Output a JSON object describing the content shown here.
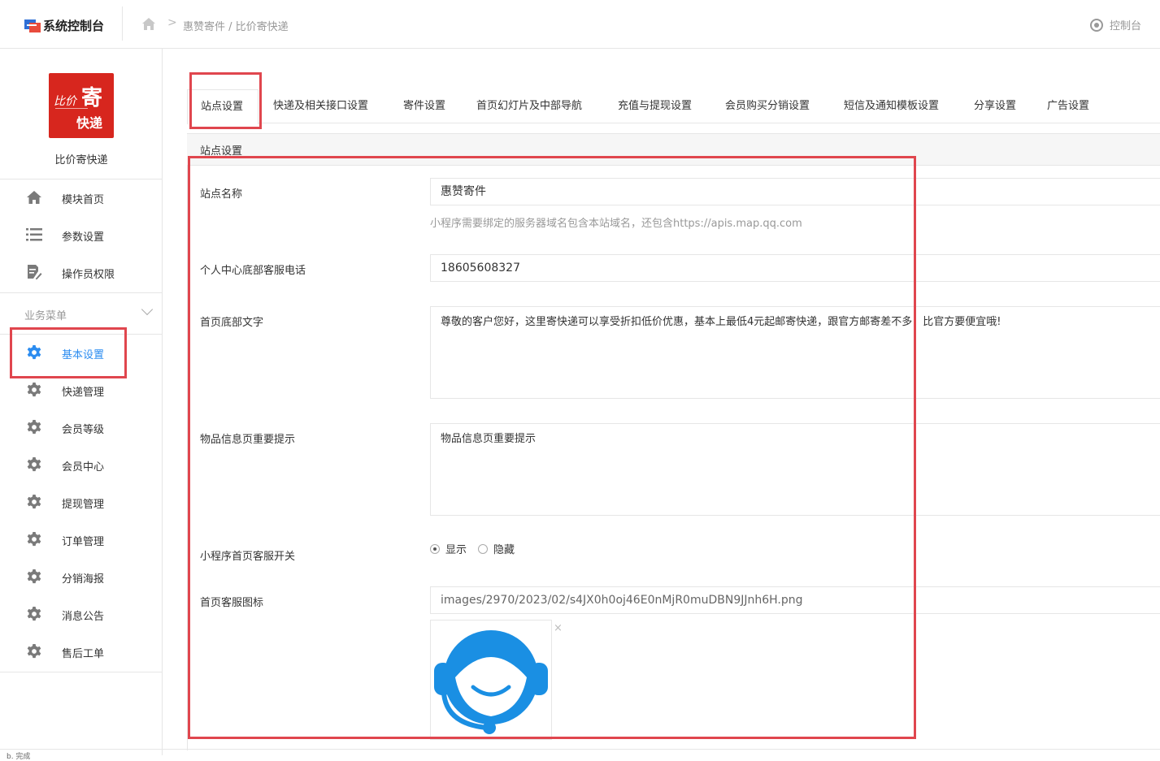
{
  "header": {
    "brand": "系统控制台",
    "breadcrumb": "惠赞寄件 / 比价寄快递",
    "breadcrumb_sep": ">",
    "console": "控制台"
  },
  "sidebar": {
    "logo": {
      "text_left": "比价",
      "text_top": "寄",
      "text_bottom": "快递"
    },
    "site_name": "比价寄快递",
    "top_items": [
      {
        "label": "模块首页",
        "icon": "home-icon"
      },
      {
        "label": "参数设置",
        "icon": "list-icon"
      },
      {
        "label": "操作员权限",
        "icon": "document-edit-icon"
      }
    ],
    "group_title": "业务菜单",
    "group_items": [
      {
        "label": "基本设置",
        "icon": "gear-icon",
        "active": true
      },
      {
        "label": "快递管理",
        "icon": "gear-icon"
      },
      {
        "label": "会员等级",
        "icon": "gear-icon"
      },
      {
        "label": "会员中心",
        "icon": "gear-icon"
      },
      {
        "label": "提现管理",
        "icon": "gear-icon"
      },
      {
        "label": "订单管理",
        "icon": "gear-icon"
      },
      {
        "label": "分销海报",
        "icon": "gear-icon"
      },
      {
        "label": "消息公告",
        "icon": "gear-icon"
      },
      {
        "label": "售后工单",
        "icon": "gear-icon"
      }
    ]
  },
  "tabs": [
    {
      "label": "站点设置",
      "active": true
    },
    {
      "label": "快递及相关接口设置"
    },
    {
      "label": "寄件设置"
    },
    {
      "label": "首页幻灯片及中部导航"
    },
    {
      "label": "充值与提现设置"
    },
    {
      "label": "会员购买分销设置"
    },
    {
      "label": "短信及通知模板设置"
    },
    {
      "label": "分享设置"
    },
    {
      "label": "广告设置"
    }
  ],
  "form": {
    "section_title": "站点设置",
    "site_name_label": "站点名称",
    "site_name_value": "惠赞寄件",
    "site_name_help": "小程序需要绑定的服务器域名包含本站域名，还包含https://apis.map.qq.com",
    "phone_label": "个人中心底部客服电话",
    "phone_value": "18605608327",
    "footer_label": "首页底部文字",
    "footer_value": "尊敬的客户您好，这里寄快递可以享受折扣低价优惠，基本上最低4元起邮寄快递，跟官方邮寄差不多，比官方要便宜哦!",
    "notice_label": "物品信息页重要提示",
    "notice_value": "物品信息页重要提示",
    "switch_label": "小程序首页客服开关",
    "switch_options": [
      "显示",
      "隐藏"
    ],
    "switch_selected": "显示",
    "icon_label": "首页客服图标",
    "icon_path": "images/2970/2023/02/s4JX0h0oj46E0nMjR0muDBN9JJnh6H.png",
    "remove_mark": "×"
  },
  "status_bar": "b.   完成",
  "colors": {
    "accent": "#2b8cf0",
    "highlight": "#e0464e",
    "logo_red": "#d7261e"
  }
}
